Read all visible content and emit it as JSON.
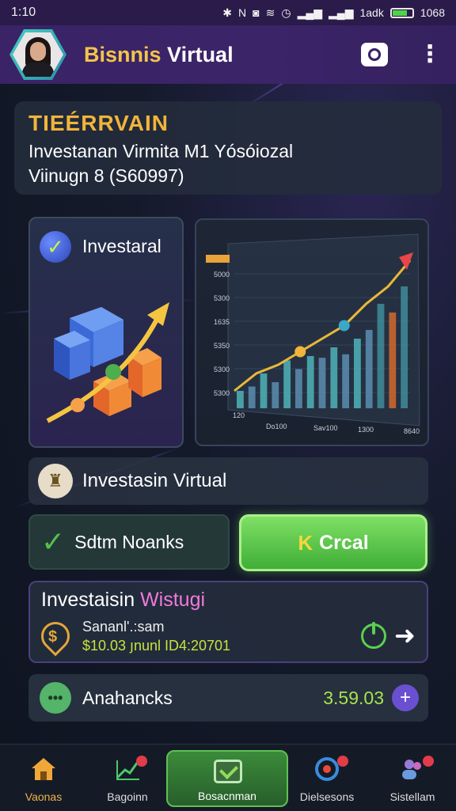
{
  "status_bar": {
    "time": "1:10",
    "status_text": "1adk",
    "battery_text": "1068"
  },
  "app_bar": {
    "title_part1": "Bisnnis",
    "title_part2": "Virtual"
  },
  "header": {
    "label": "TIEÉRRVAIN",
    "line1": "Investanan Virmita M1 Yósóiozal",
    "line2": "Viinugn 8 (S60997)"
  },
  "invest_card": {
    "label": "Investaral"
  },
  "chart_data": {
    "type": "bar",
    "y_ticks": [
      "5000",
      "5300",
      "1635",
      "5350",
      "5300",
      "5300"
    ],
    "x_ticks": [
      "120",
      "Do100",
      "Sav100",
      "1300",
      "8640"
    ],
    "bar_values": [
      2,
      2.5,
      4,
      3,
      5.5,
      4.5,
      6,
      5.8,
      7,
      6.2,
      8,
      9,
      12,
      11,
      14
    ],
    "trend_values": [
      2,
      4,
      5,
      6.5,
      8,
      9.5,
      12,
      14,
      17
    ]
  },
  "row_virtual": {
    "label": "Investasin Virtual"
  },
  "buttons": {
    "dark_label": "Sdtm Noanks",
    "green_prefix": "K",
    "green_label": "Crcal"
  },
  "wisdom": {
    "title_part1": "Investaisin",
    "title_part2": "Wistugi",
    "subtitle": "Sananl'.:sam",
    "value": "$10.03 յnunl ID4:20701"
  },
  "balance": {
    "label": "Anahancks",
    "value": "3.59.03"
  },
  "bottom_nav": {
    "items": [
      {
        "label": "Vaonas"
      },
      {
        "label": "Bagoinn"
      },
      {
        "label": "Bosacnman"
      },
      {
        "label": "Dielsesons"
      },
      {
        "label": "Sistellam"
      }
    ]
  },
  "colors": {
    "accent_gold": "#f2b43a",
    "accent_green": "#5ad04e",
    "accent_purple": "#6b4fd1"
  }
}
